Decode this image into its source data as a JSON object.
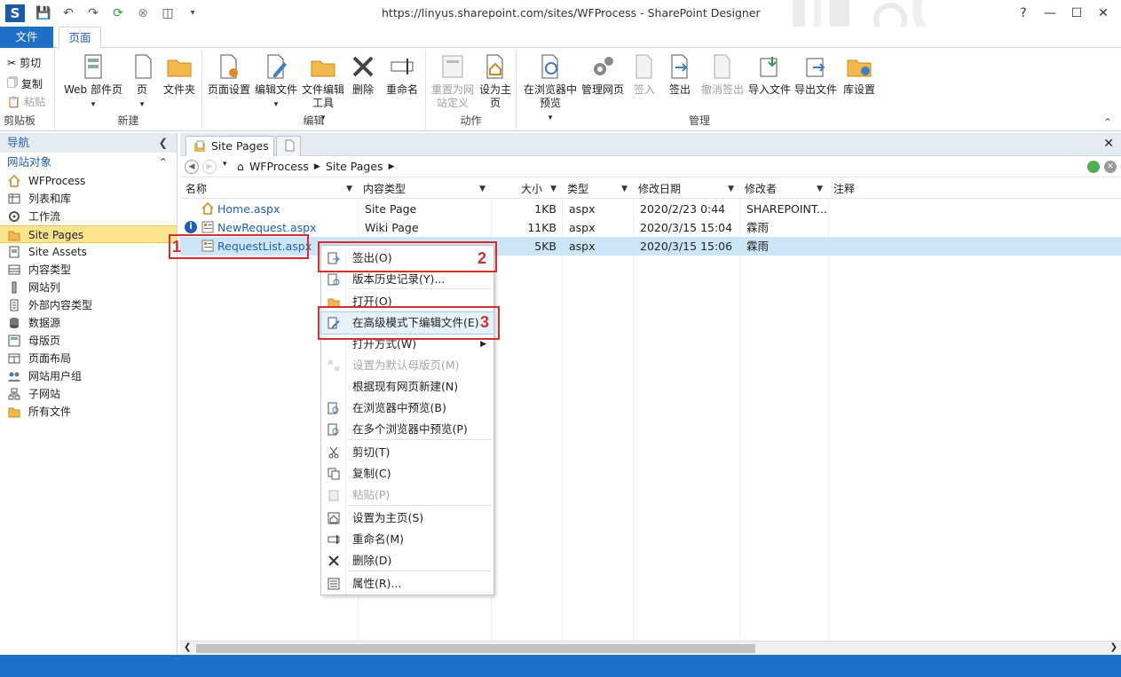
{
  "window": {
    "title": "https://linyus.sharepoint.com/sites/WFProcess - SharePoint Designer",
    "help": "?",
    "minimize": "—",
    "maximize": "☐",
    "close": "✕"
  },
  "ribbon_tabs": [
    {
      "label": "文件"
    },
    {
      "label": "页面"
    }
  ],
  "ribbon": {
    "clipboard": {
      "label": "剪贴板",
      "cut": "剪切",
      "copy": "复制",
      "paste": "粘贴"
    },
    "new": {
      "label": "新建",
      "web_part_page": "Web 部件页",
      "page": "页",
      "folder": "文件夹"
    },
    "edit": {
      "label": "编辑",
      "page_settings": "页面设置",
      "edit_file": "编辑文件",
      "edit_tools": "文件编辑工具",
      "delete": "删除",
      "rename": "重命名"
    },
    "actions": {
      "label": "动作",
      "reset": "重置为网站定义",
      "set_home": "设为主页"
    },
    "manage": {
      "label": "管理",
      "preview": "在浏览器中预览",
      "admin": "管理网页",
      "checkin": "签入",
      "checkout": "签出",
      "undo_checkout": "撤消签出",
      "import": "导入文件",
      "export": "导出文件",
      "lib_settings": "库设置"
    }
  },
  "nav": {
    "header": "导航",
    "section": "网站对象",
    "items": [
      {
        "label": "WFProcess",
        "icon": "home-icon"
      },
      {
        "label": "列表和库",
        "icon": "list-icon"
      },
      {
        "label": "工作流",
        "icon": "workflow-icon"
      },
      {
        "label": "Site Pages",
        "icon": "folder-icon",
        "selected": true
      },
      {
        "label": "Site Assets",
        "icon": "assets-icon"
      },
      {
        "label": "内容类型",
        "icon": "content-type-icon"
      },
      {
        "label": "网站列",
        "icon": "column-icon"
      },
      {
        "label": "外部内容类型",
        "icon": "external-content-icon"
      },
      {
        "label": "数据源",
        "icon": "data-source-icon"
      },
      {
        "label": "母版页",
        "icon": "master-page-icon"
      },
      {
        "label": "页面布局",
        "icon": "page-layout-icon"
      },
      {
        "label": "网站用户组",
        "icon": "users-icon"
      },
      {
        "label": "子网站",
        "icon": "subsite-icon"
      },
      {
        "label": "所有文件",
        "icon": "all-files-icon"
      }
    ]
  },
  "doc_tab": {
    "label": "Site Pages"
  },
  "breadcrumb": {
    "root": "WFProcess",
    "current": "Site Pages"
  },
  "columns": [
    "名称",
    "内容类型",
    "大小",
    "类型",
    "修改日期",
    "修改者",
    "注释"
  ],
  "rows": [
    {
      "name": "Home.aspx",
      "ctype": "Site Page",
      "size": "1KB",
      "type": "aspx",
      "date": "2020/2/23 0:44",
      "by": "SHAREPOINT..."
    },
    {
      "name": "NewRequest.aspx",
      "ctype": "Wiki Page",
      "size": "11KB",
      "type": "aspx",
      "date": "2020/3/15 15:04",
      "by": "霖雨"
    },
    {
      "name": "RequestList.aspx",
      "ctype": "",
      "size": "5KB",
      "type": "aspx",
      "date": "2020/3/15 15:06",
      "by": "霖雨"
    }
  ],
  "context_menu": [
    {
      "label": "签出(O)",
      "disabled": false
    },
    {
      "label": "版本历史记录(Y)...",
      "disabled": false
    },
    {
      "label": "打开(O)",
      "disabled": false
    },
    {
      "label": "在高级模式下编辑文件(E)",
      "disabled": false
    },
    {
      "label": "打开方式(W)",
      "disabled": false
    },
    {
      "label": "设置为默认母版页(M)",
      "disabled": true
    },
    {
      "label": "根据现有网页新建(N)",
      "disabled": false
    },
    {
      "label": "在浏览器中预览(B)",
      "disabled": false
    },
    {
      "label": "在多个浏览器中预览(P)",
      "disabled": false
    },
    {
      "label": "剪切(T)",
      "disabled": false
    },
    {
      "label": "复制(C)",
      "disabled": false
    },
    {
      "label": "粘贴(P)",
      "disabled": true
    },
    {
      "label": "设置为主页(S)",
      "disabled": false
    },
    {
      "label": "重命名(M)",
      "disabled": false
    },
    {
      "label": "删除(D)",
      "disabled": false
    },
    {
      "label": "属性(R)...",
      "disabled": false
    }
  ],
  "annotations": [
    "1",
    "2",
    "3"
  ],
  "colors": {
    "accent": "#1e6fc5",
    "selection": "#cde6f7",
    "nav_selected": "#fde58e",
    "annotation": "#d32f2f"
  }
}
